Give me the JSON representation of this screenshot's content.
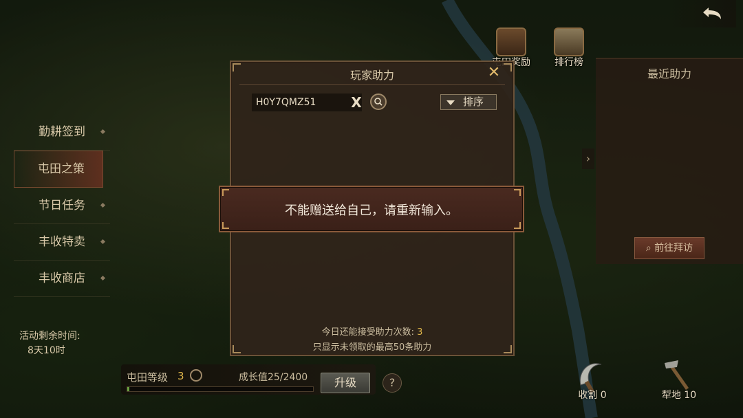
{
  "top_bar": {
    "icons": [
      {
        "label": "屯田奖励",
        "icon": "treasure-chest-icon"
      },
      {
        "label": "排行榜",
        "icon": "ranking-scroll-icon"
      }
    ]
  },
  "left_menu": {
    "items": [
      {
        "label": "勤耕签到",
        "active": false
      },
      {
        "label": "屯田之策",
        "active": true
      },
      {
        "label": "节日任务",
        "active": false
      },
      {
        "label": "丰收特卖",
        "active": false
      },
      {
        "label": "丰收商店",
        "active": false
      }
    ],
    "time_label": "活动剩余时间:",
    "time_value": "8天10时"
  },
  "bottom_bar": {
    "level_label": "屯田等级",
    "level_value": "3",
    "growth_label": "成长值25/2400",
    "growth_progress": 0.0104,
    "upgrade_label": "升级",
    "help_label": "?"
  },
  "tools": [
    {
      "label": "收割 0",
      "icon": "sickle-icon"
    },
    {
      "label": "犁地 10",
      "icon": "hoe-icon"
    }
  ],
  "right_panel": {
    "title": "最近助力",
    "visit_button": "前往拜访"
  },
  "modal": {
    "title": "玩家助力",
    "search_value": "H0Y7QMZ51",
    "clear_label": "X",
    "sort_label": "排序",
    "count_text": "今日还能接受助力次数: ",
    "count_value": "3",
    "note": "只显示未领取的最高50条助力"
  },
  "toast": {
    "message": "不能赠送给自己，请重新输入。"
  },
  "colors": {
    "accent_gold": "#e0b74a",
    "panel_brown": "#30241a",
    "toast_red": "#4a2a20"
  }
}
